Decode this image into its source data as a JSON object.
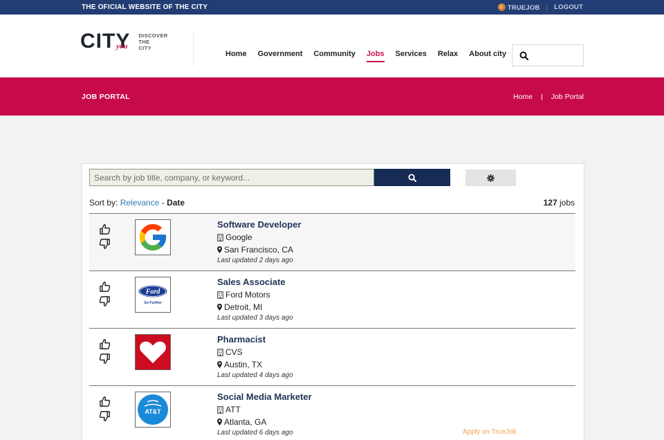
{
  "topbar": {
    "title": "THE OFICIAL WEBSITE OF THE CITY",
    "account": "TRUEJOB",
    "logout": "LOGOUT"
  },
  "header": {
    "logo_text": "CITY",
    "logo_script": "you",
    "logo_tagline": [
      "DISCOVER",
      "THE",
      "CITY"
    ],
    "nav": [
      "Home",
      "Government",
      "Community",
      "Jobs",
      "Services",
      "Relax",
      "About city"
    ],
    "active_nav": "Jobs"
  },
  "banner": {
    "title": "JOB PORTAL",
    "breadcrumb": [
      "Home",
      "|",
      "Job Portal"
    ]
  },
  "search": {
    "placeholder": "Search by job title, company, or keyword..."
  },
  "sort": {
    "label": "Sort by:",
    "relevance": "Relevance",
    "dash": "-",
    "date": "Date"
  },
  "count": {
    "number": "127",
    "unit": "jobs"
  },
  "jobs": [
    {
      "title": "Software Developer",
      "company": "Google",
      "location": "San Francisco, CA",
      "updated": "Last updated 2 days ago"
    },
    {
      "title": "Sales Associate",
      "company": "Ford Motors",
      "location": "Detroit, MI",
      "updated": "Last updated 3 days ago"
    },
    {
      "title": "Pharmacist",
      "company": "CVS",
      "location": "Austin, TX",
      "updated": "Last updated 4 days ago"
    },
    {
      "title": "Social Media Marketer",
      "company": "ATT",
      "location": "Atlanta, GA",
      "updated": "Last updated 6 days ago"
    }
  ],
  "apply_label": "Apply on TrueJob",
  "logo_text": {
    "ford": "Ford",
    "ford_sub": "Go Further",
    "att": "AT&T"
  },
  "colors": {
    "topbar": "#223d73",
    "brand": "#c70a4a",
    "search_button": "#162c54",
    "link": "#2e7ab5",
    "apply": "#f0a04a"
  }
}
